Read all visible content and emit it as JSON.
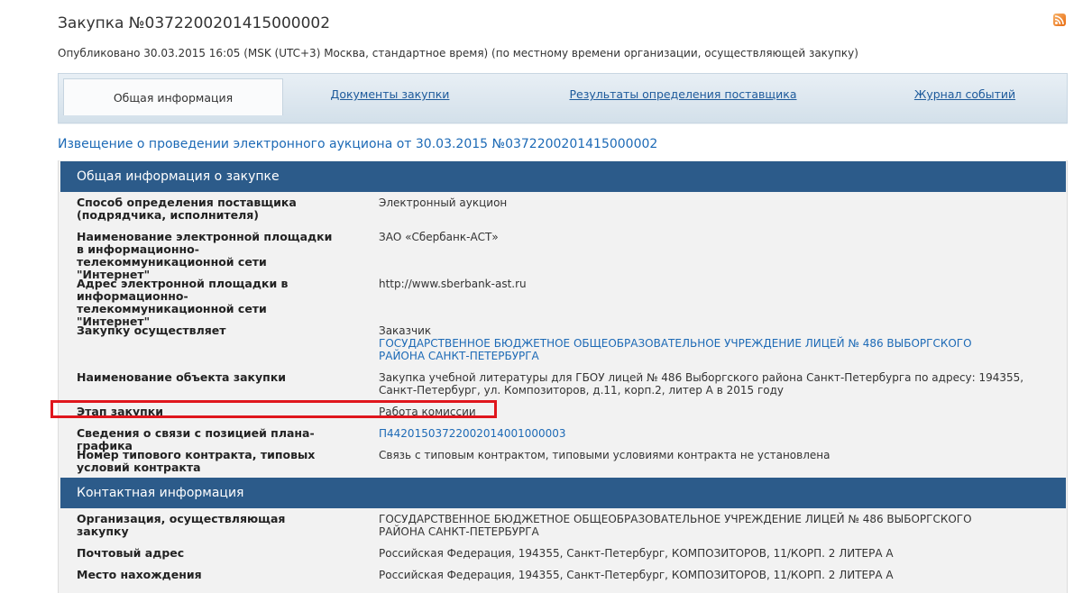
{
  "header": {
    "title": "Закупка №0372200201415000002",
    "published": "Опубликовано 30.03.2015 16:05 (MSK (UTC+3) Москва, стандартное время) (по местному времени организации, осуществляющей закупку)"
  },
  "tabs": [
    {
      "label": "Общая информация"
    },
    {
      "label": "Документы закупки"
    },
    {
      "label": "Результаты определения поставщика"
    },
    {
      "label": "Журнал событий"
    }
  ],
  "notice_link": "Извещение о проведении электронного аукциона от 30.03.2015 №0372200201415000002",
  "general": {
    "title": "Общая информация о закупке",
    "rows": [
      {
        "label": "Способ определения поставщика (подрядчика, исполнителя)",
        "value": "Электронный аукцион"
      },
      {
        "label": "Наименование электронной площадки в информационно-телекоммуникационной сети \"Интернет\"",
        "value": "ЗАО «Сбербанк-АСТ»"
      },
      {
        "label": "Адрес электронной площадки в информационно-телекоммуникационной сети \"Интернет\"",
        "value": "http://www.sberbank-ast.ru"
      },
      {
        "label": "Закупку осуществляет",
        "value": "Заказчик",
        "value_link": "ГОСУДАРСТВЕННОЕ БЮДЖЕТНОЕ ОБЩЕОБРАЗОВАТЕЛЬНОЕ УЧРЕЖДЕНИЕ ЛИЦЕЙ № 486 ВЫБОРГСКОГО РАЙОНА САНКТ-ПЕТЕРБУРГА"
      },
      {
        "label": "Наименование объекта закупки",
        "value": "Закупка учебной литературы для ГБОУ лицей № 486 Выборгского района Санкт-Петербурга по адресу: 194355, Санкт-Петербург, ул. Композиторов, д.11, корп.2, литер А в 2015 году"
      },
      {
        "label": "Этап закупки",
        "value": "Работа комиссии"
      },
      {
        "label": "Сведения о связи с позицией плана-графика",
        "value": "П44201503722002014001000003"
      },
      {
        "label": "Номер типового контракта, типовых условий контракта",
        "value": "Связь с типовым контрактом, типовыми условиями контракта не установлена"
      }
    ]
  },
  "contact": {
    "title": "Контактная информация",
    "rows": [
      {
        "label": "Организация, осуществляющая закупку",
        "value": "ГОСУДАРСТВЕННОЕ БЮДЖЕТНОЕ ОБЩЕОБРАЗОВАТЕЛЬНОЕ УЧРЕЖДЕНИЕ ЛИЦЕЙ № 486 ВЫБОРГСКОГО РАЙОНА САНКТ-ПЕТЕРБУРГА"
      },
      {
        "label": "Почтовый адрес",
        "value": "Российская Федерация, 194355, Санкт-Петербург, КОМПОЗИТОРОВ, 11/КОРП. 2 ЛИТЕРА А"
      },
      {
        "label": "Место нахождения",
        "value": "Российская Федерация, 194355, Санкт-Петербург, КОМПОЗИТОРОВ, 11/КОРП. 2 ЛИТЕРА А"
      }
    ]
  },
  "colors": {
    "header_bar": "#2c5b8a",
    "link": "#1d6ab6",
    "highlight": "#e0161d"
  }
}
